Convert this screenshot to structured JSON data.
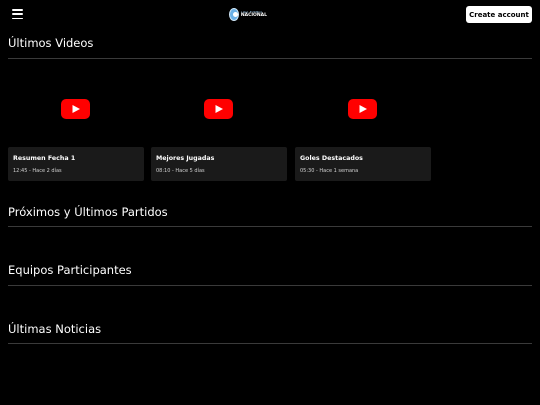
{
  "header": {
    "logo": {
      "line1": "LIGA FUTBOL",
      "line2": "NACIONAL"
    },
    "create_account_label": "Create account"
  },
  "sections": {
    "videos_title": "Últimos Videos",
    "matches_title": "Próximos y Últimos Partidos",
    "teams_title": "Equipos Participantes",
    "news_title": "Últimas Noticias"
  },
  "videos": [
    {
      "title": "Resumen Fecha 1",
      "meta": "12:45 - Hace 2 días"
    },
    {
      "title": "Mejores Jugadas",
      "meta": "08:10 - Hace 5 días"
    },
    {
      "title": "Goles Destacados",
      "meta": "05:30 - Hace 1 semana"
    }
  ],
  "colors": {
    "background": "#000000",
    "card": "#1a1a1a",
    "play_button": "#ff0000",
    "divider": "#3a3a3a"
  }
}
